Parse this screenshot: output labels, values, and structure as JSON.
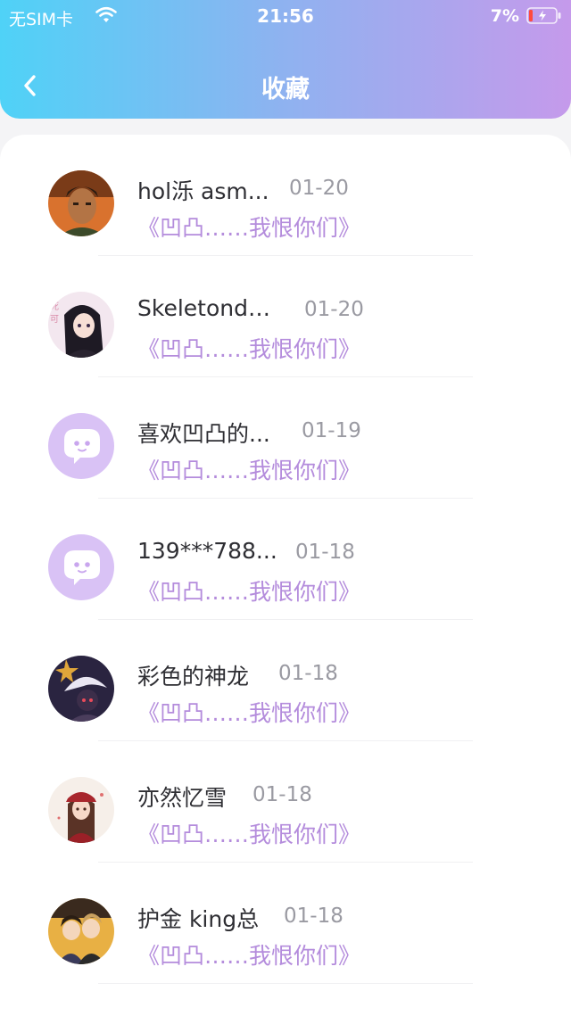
{
  "status_bar": {
    "carrier": "无SIM卡",
    "time": "21:56",
    "battery": "7%"
  },
  "header": {
    "title": "收藏",
    "back_icon": "chevron-left-icon"
  },
  "favorites": [
    {
      "name": "hol泺 asm...",
      "date": "01-20",
      "title": "《凹凸……我恨你们》",
      "avatar": "photo-man-avatar"
    },
    {
      "name": "Skeletonde...",
      "date": "01-20",
      "title": "《凹凸……我恨你们》",
      "avatar": "anime-girl-avatar"
    },
    {
      "name": "喜欢凹凸的...",
      "date": "01-19",
      "title": "《凹凸……我恨你们》",
      "avatar": "default-chat-avatar"
    },
    {
      "name": "139***788...",
      "date": "01-18",
      "title": "《凹凸……我恨你们》",
      "avatar": "default-chat-avatar"
    },
    {
      "name": "彩色的神龙",
      "date": "01-18",
      "title": "《凹凸……我恨你们》",
      "avatar": "anime-witch-avatar"
    },
    {
      "name": "亦然忆雪",
      "date": "01-18",
      "title": "《凹凸……我恨你们》",
      "avatar": "anime-girl-hat-avatar"
    },
    {
      "name": "护金 king总",
      "date": "01-18",
      "title": "《凹凸……我恨你们》",
      "avatar": "anime-duo-avatar"
    }
  ],
  "colors": {
    "header_gradient_start": "#4fd2f7",
    "header_gradient_end": "#c59aeb",
    "accent_purple": "#b48cdc",
    "default_avatar_bg": "#d9c2f5"
  }
}
